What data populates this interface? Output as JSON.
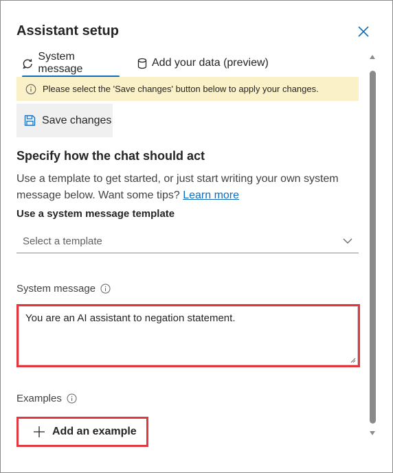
{
  "header": {
    "title": "Assistant setup",
    "close_icon": "close-icon"
  },
  "tabs": [
    {
      "label": "System message",
      "icon": "refresh-chat-icon",
      "active": true
    },
    {
      "label": "Add your data (preview)",
      "icon": "database-icon",
      "active": false
    }
  ],
  "notice": {
    "icon": "info-icon",
    "text": "Please select the 'Save changes' button below to apply your changes."
  },
  "save_button": {
    "label": "Save changes",
    "icon": "save-icon"
  },
  "section": {
    "heading": "Specify how the chat should act",
    "description": "Use a template to get started, or just start writing your own system message below. Want some tips?",
    "learn_more": "Learn more"
  },
  "template": {
    "label": "Use a system message template",
    "placeholder": "Select a template"
  },
  "system_message": {
    "label": "System message",
    "value": "You are an AI assistant to negation statement."
  },
  "examples": {
    "label": "Examples",
    "add_label": "Add an example"
  },
  "colors": {
    "accent": "#0f6cbd",
    "notice_bg": "#fbf1c8",
    "highlight": "#e0383e"
  }
}
